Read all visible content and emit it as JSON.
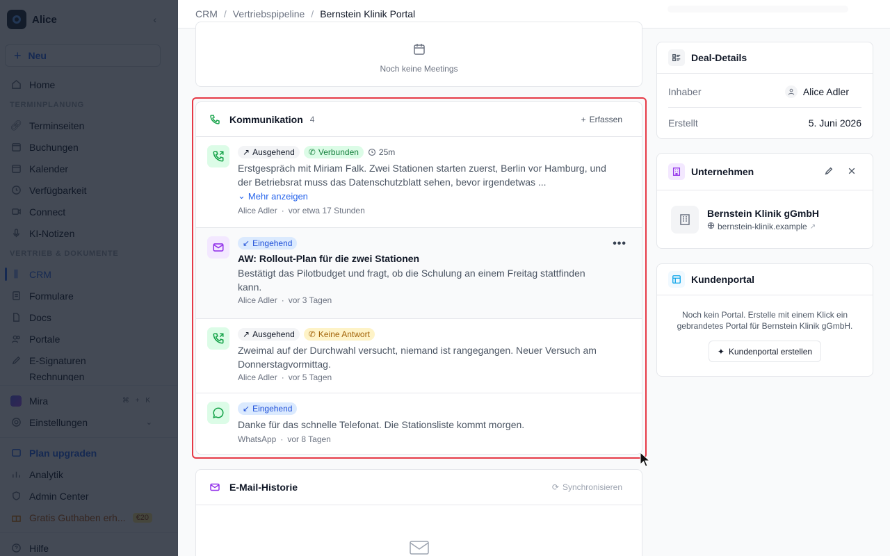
{
  "sidebar": {
    "workspace": "Alice",
    "new_label": "Neu",
    "home": "Home",
    "section_scheduling": "TERMINPLANUNG",
    "scheduling_items": [
      "Terminseiten",
      "Buchungen",
      "Kalender",
      "Verfügbarkeit",
      "Connect",
      "KI-Notizen"
    ],
    "section_sales": "VERTRIEB & DOKUMENTE",
    "sales_items": [
      "CRM",
      "Formulare",
      "Docs",
      "Portale",
      "E-Signaturen",
      "Rechnungen"
    ],
    "mira": "Mira",
    "mira_kbd": "⌘ + K",
    "settings": "Einstellungen",
    "upgrade": "Plan upgraden",
    "analytics": "Analytik",
    "admin": "Admin Center",
    "credit": "Gratis Guthaben erh...",
    "credit_badge": "€20",
    "help": "Hilfe"
  },
  "breadcrumb": {
    "root": "CRM",
    "middle": "Vertriebspipeline",
    "current": "Bernstein Klinik Portal"
  },
  "meetings": {
    "empty_text": "Noch keine Meetings"
  },
  "communication": {
    "title": "Kommunikation",
    "count": "4",
    "action": "Erfassen",
    "items": [
      {
        "direction": "Ausgehend",
        "status": "Verbunden",
        "duration": "25m",
        "body": "Erstgespräch mit Miriam Falk. Zwei Stationen starten zuerst, Berlin vor Hamburg, und der Betriebsrat muss das Datenschutzblatt sehen, bevor irgendetwas ...",
        "more": "Mehr anzeigen",
        "author": "Alice Adler",
        "time": "vor etwa 17 Stunden"
      },
      {
        "direction": "Eingehend",
        "subject": "AW: Rollout-Plan für die zwei Stationen",
        "body": "Bestätigt das Pilotbudget und fragt, ob die Schulung an einem Freitag stattfinden kann.",
        "author": "Alice Adler",
        "time": "vor 3 Tagen"
      },
      {
        "direction": "Ausgehend",
        "status": "Keine Antwort",
        "body": "Zweimal auf der Durchwahl versucht, niemand ist rangegangen. Neuer Versuch am Donnerstagvormittag.",
        "author": "Alice Adler",
        "time": "vor 5 Tagen"
      },
      {
        "direction": "Eingehend",
        "body": "Danke für das schnelle Telefonat. Die Stationsliste kommt morgen.",
        "author": "WhatsApp",
        "time": "vor 8 Tagen"
      }
    ]
  },
  "email_history": {
    "title": "E-Mail-Historie",
    "action": "Synchronisieren"
  },
  "deal_details": {
    "title": "Deal-Details",
    "owner_label": "Inhaber",
    "owner_value": "Alice Adler",
    "created_label": "Erstellt",
    "created_value": "5. Juni 2026"
  },
  "company": {
    "title": "Unternehmen",
    "name": "Bernstein Klinik gGmbH",
    "url": "bernstein-klinik.example"
  },
  "portal": {
    "title": "Kundenportal",
    "text": "Noch kein Portal. Erstelle mit einem Klick ein gebrandetes Portal für Bernstein Klinik gGmbH.",
    "button": "Kundenportal erstellen"
  },
  "colors": {
    "accent": "#2563eb",
    "highlight": "#e63946",
    "success": "#15803d",
    "warning": "#a16207"
  }
}
